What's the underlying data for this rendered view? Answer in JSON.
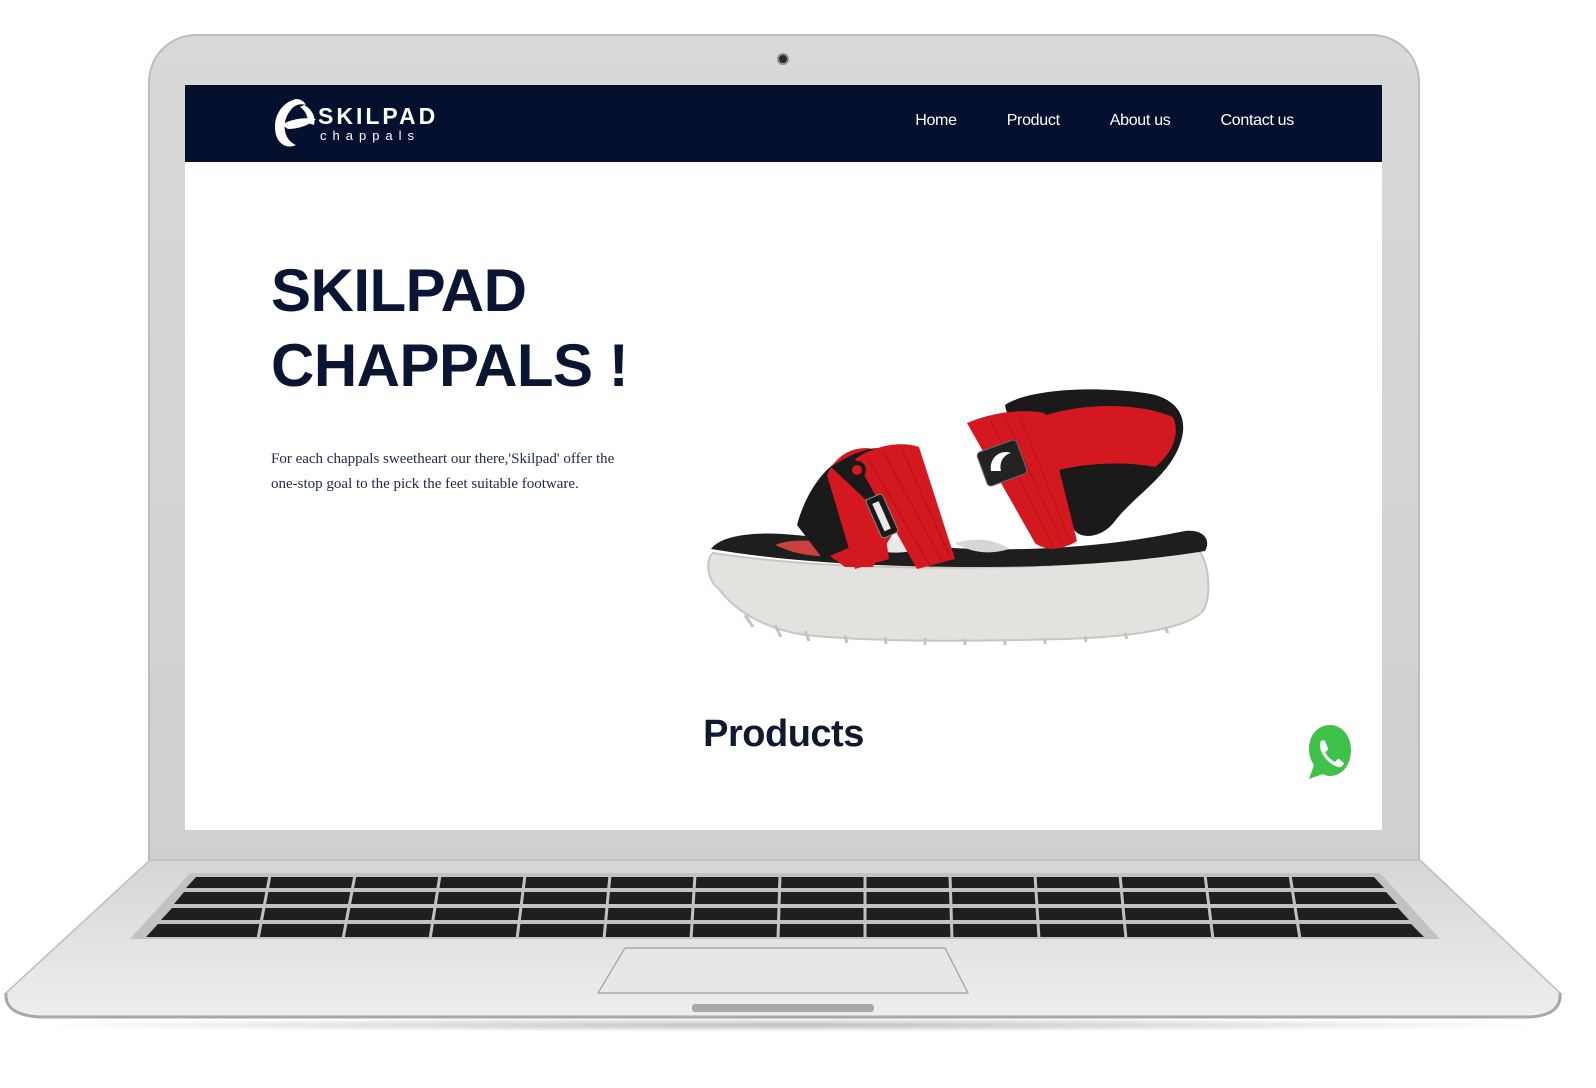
{
  "brand": {
    "logo_name": "SKILPAD",
    "logo_tagline": "chappals"
  },
  "nav": {
    "items": [
      {
        "label": "Home"
      },
      {
        "label": "Product"
      },
      {
        "label": "About us"
      },
      {
        "label": "Contact us"
      }
    ]
  },
  "hero": {
    "title_line1": "SKILPAD",
    "title_line2": "CHAPPALS !",
    "description": "For each chappals sweetheart our there,'Skilpad' offer the one-stop goal to the pick the feet suitable footware."
  },
  "products": {
    "heading": "Products"
  },
  "floating": {
    "whatsapp_icon": "whatsapp-icon",
    "whatsapp_color": "#3ec24a"
  },
  "colors": {
    "navbar_bg": "#04102d",
    "title_text": "#0a1533",
    "sandal_strap": "#d4181f",
    "sandal_sole": "#e4e2df"
  }
}
